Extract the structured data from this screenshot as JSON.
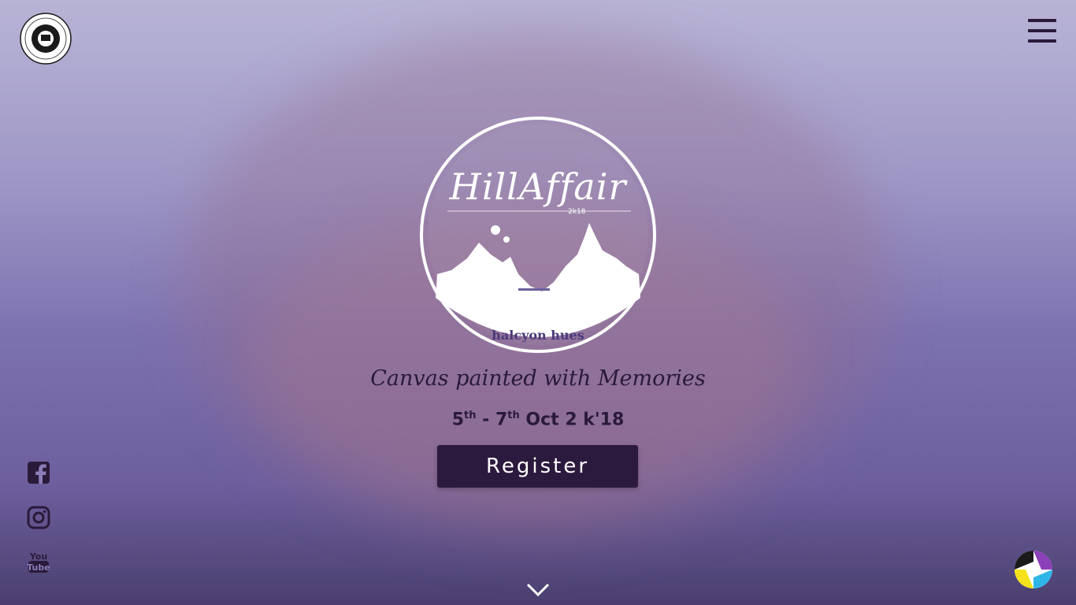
{
  "header": {
    "college_logo_icon": "college-seal-icon",
    "menu_icon": "hamburger-menu-icon"
  },
  "hero": {
    "logo_title": "HillAffair",
    "logo_year": "2k18",
    "logo_subtitle": "halcyon hues",
    "tagline": "Canvas painted with Memories",
    "dates": {
      "start_day": "5",
      "start_suffix": "th",
      "separator": " - ",
      "end_day": "7",
      "end_suffix": "th",
      "rest": " Oct 2 k'18"
    },
    "register_label": "Register"
  },
  "social": {
    "facebook_icon": "facebook-icon",
    "instagram_icon": "instagram-icon",
    "youtube_icon": "youtube-icon"
  },
  "footer": {
    "scroll_icon": "chevron-down-icon",
    "corner_icon": "aperture-logo-icon"
  },
  "colors": {
    "primary_dark": "#2c1a3e",
    "text_dark": "#2a1a3a",
    "bg_purple": "#7d72b0"
  }
}
